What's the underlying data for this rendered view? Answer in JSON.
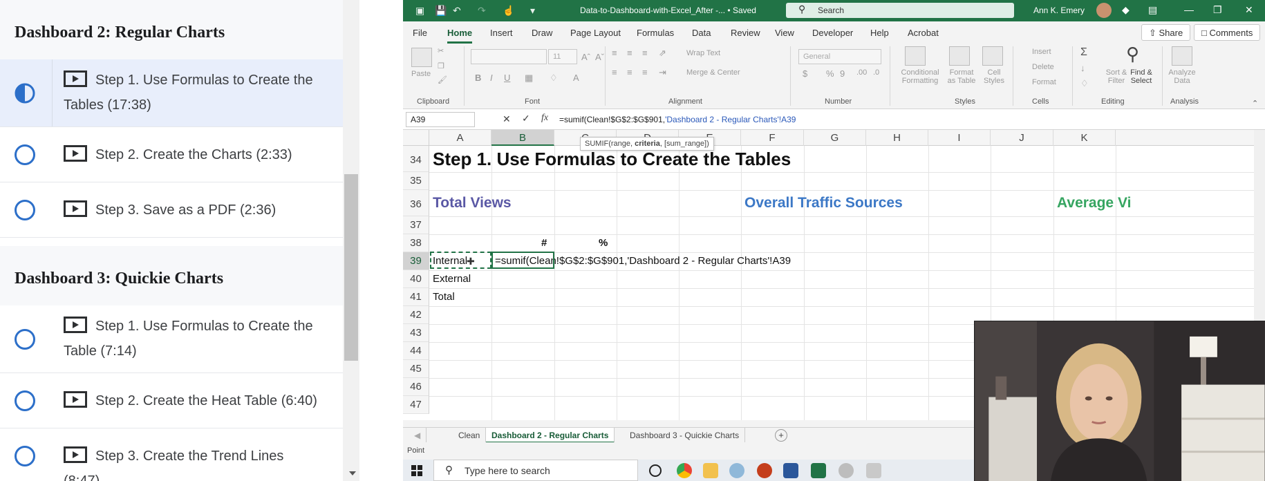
{
  "course": {
    "sections": [
      {
        "title": "Dashboard 2: Regular Charts",
        "lessons": [
          {
            "label": "Step 1. Use Formulas to Create the Tables (17:38)",
            "state": "in-progress"
          },
          {
            "label": "Step 2. Create the Charts (2:33)",
            "state": "not-started"
          },
          {
            "label": "Step 3. Save as a PDF (2:36)",
            "state": "not-started"
          }
        ]
      },
      {
        "title": "Dashboard 3: Quickie Charts",
        "lessons": [
          {
            "label": "Step 1. Use Formulas to Create the Table (7:14)",
            "state": "not-started"
          },
          {
            "label": "Step 2. Create the Heat Table (6:40)",
            "state": "not-started"
          },
          {
            "label": "Step 3. Create the Trend Lines (8:47)",
            "state": "not-started"
          }
        ]
      }
    ]
  },
  "excel": {
    "doc_title": "Data-to-Dashboard-with-Excel_After -...  •  Saved",
    "search_placeholder": "Search",
    "user_name": "Ann K. Emery",
    "menu": [
      "File",
      "Home",
      "Insert",
      "Draw",
      "Page Layout",
      "Formulas",
      "Data",
      "Review",
      "View",
      "Developer",
      "Help",
      "Acrobat"
    ],
    "active_menu": "Home",
    "share_label": "Share",
    "comments_label": "Comments",
    "ribbon": {
      "groups": [
        "Clipboard",
        "Font",
        "Alignment",
        "Number",
        "Styles",
        "Cells",
        "Editing",
        "Analysis"
      ],
      "paste": "Paste",
      "font_size": "11",
      "wrap_text": "Wrap Text",
      "merge_center": "Merge & Center",
      "number_format": "General",
      "conditional_formatting": "Conditional Formatting",
      "format_as_table": "Format as Table",
      "cell_styles": "Cell Styles",
      "insert": "Insert",
      "delete": "Delete",
      "format": "Format",
      "sort_filter": "Sort & Filter",
      "find_select": "Find & Select",
      "analyze_data": "Analyze Data"
    },
    "name_box": "A39",
    "formula_prefix": "=sumif(Clean!$G$2:$G$901,",
    "formula_ref": "'Dashboard 2 - Regular Charts'!A39",
    "tooltip": {
      "pre": "SUMIF(range, ",
      "bold": "criteria",
      "post": ", [sum_range])"
    },
    "columns": [
      "A",
      "B",
      "C",
      "D",
      "E",
      "F",
      "G",
      "H",
      "I",
      "J",
      "K"
    ],
    "rows": [
      "34",
      "35",
      "36",
      "37",
      "38",
      "39",
      "40",
      "41",
      "42",
      "43",
      "44",
      "45",
      "46",
      "47"
    ],
    "cells": {
      "step_title": "Step 1. Use Formulas to Create the Tables",
      "total_views": "Total Views",
      "overall_traffic": "Overall Traffic Sources",
      "average_views": "Average Vi",
      "hash": "#",
      "pct": "%",
      "internal": "Internal",
      "external": "External",
      "total": "Total",
      "editing_formula": "=sumif(Clean!$G$2:$G$901,'Dashboard 2 - Regular Charts'!A39"
    },
    "sheets": [
      "Clean",
      "Dashboard 2 - Regular Charts",
      "Dashboard 3 - Quickie Charts"
    ],
    "active_sheet": "Dashboard 2 - Regular Charts",
    "status_mode": "Point",
    "taskbar_search": "Type here to search",
    "accent": "#217346"
  }
}
